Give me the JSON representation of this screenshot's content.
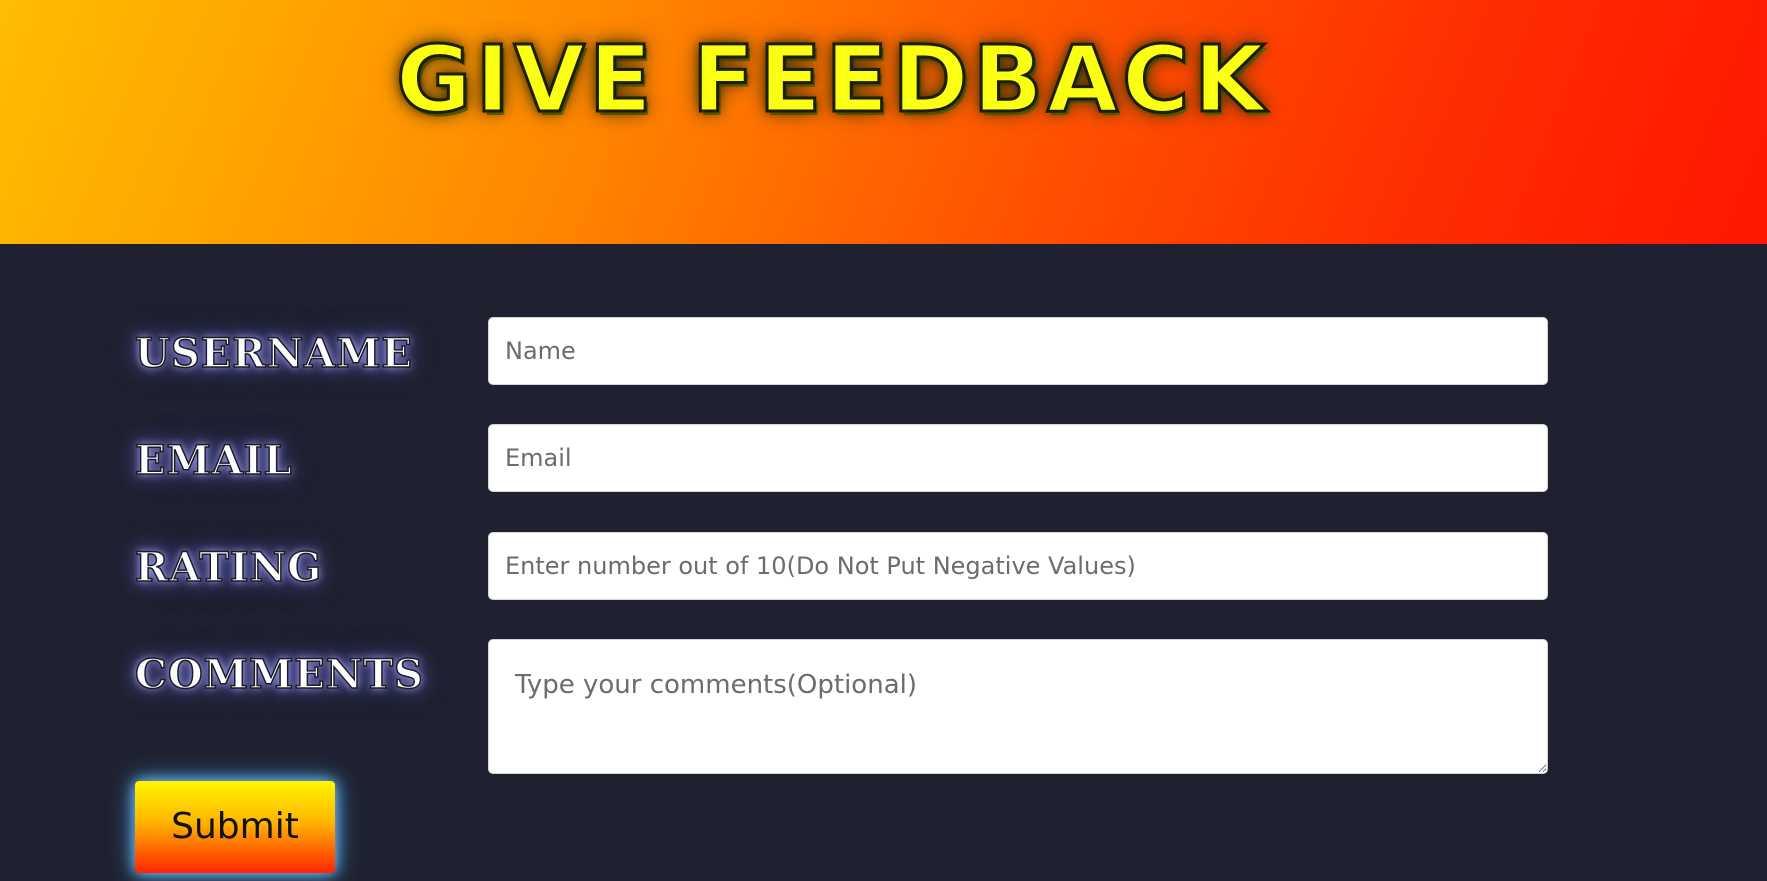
{
  "header": {
    "title": "GIVE FEEDBACK"
  },
  "form": {
    "username_label": "USERNAME",
    "username_placeholder": "Name",
    "email_label": "EMAIL",
    "email_placeholder": "Email",
    "rating_label": "RATING",
    "rating_placeholder": "Enter number out of 10(Do Not Put Negative Values)",
    "comments_label": "COMMENTS",
    "comments_placeholder": "Type your comments(Optional)",
    "submit_label": "Submit"
  },
  "colors": {
    "background": "#1f2130",
    "header_gradient_start": "#ffbd00",
    "header_gradient_end": "#ff1600",
    "title_color": "#fbff14",
    "submit_gradient_top": "#fff700",
    "submit_gradient_bottom": "#ff2400"
  }
}
